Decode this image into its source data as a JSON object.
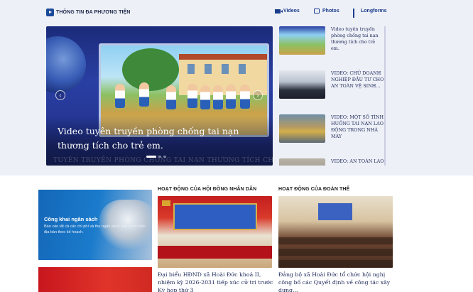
{
  "multimedia": {
    "title": "THÔNG TIN ĐA PHƯƠNG TIỆN",
    "nav": [
      {
        "label": "Videos",
        "icon": "video-icon"
      },
      {
        "label": "Photos",
        "icon": "photo-icon"
      },
      {
        "label": "Longforms",
        "icon": "chart-icon"
      }
    ],
    "slider": {
      "caption": "Video tuyên truyền phòng chống tai nạn thương tích cho trẻ em.",
      "overlay_text": "TUYÊN TRUYỀN PHÒNG CHỐNG TAI NẠN THƯƠNG TÍCH CHO TRẺ EM",
      "prev_icon": "chevron-left-icon",
      "next_icon": "chevron-right-icon",
      "active_slide": 1,
      "slide_count": 3
    },
    "video_list": [
      {
        "title": "Video tuyên truyền phòng chống tai nạn thương tích cho trẻ em."
      },
      {
        "title": "VIDEO: CHỦ DOANH NGHIỆP ĐẦU TƯ CHO AN TOÀN VỆ SINH..."
      },
      {
        "title": "VIDEO: MỘT SỐ TÌNH HUỐNG TAI NẠN LAO ĐỘNG TRONG NHÀ MÁY"
      },
      {
        "title": "VIDEO: AN TOÀN LAO"
      }
    ]
  },
  "banners": {
    "budget": {
      "title": "Công khai ngân sách",
      "description": "Báo cáo tất cả các chi phí và thu ngân sách nhà nước trên địa bàn theo kế hoạch."
    }
  },
  "sections": [
    {
      "heading": "HOẠT ĐỘNG CỦA HỘI ĐỒNG NHÂN DÂN",
      "article_title": "Đại biểu HĐND xã Hoài Đức khoá II, nhiệm kỳ 2026-2031 tiếp xúc cử tri trước Kỳ họp thứ 3"
    },
    {
      "heading": "HOẠT ĐỘNG CỦA ĐOÀN THỂ",
      "article_title": "Đảng bộ xã Hoài Đức tổ chức hội nghị công bố các Quyết định về công tác xây dựng..."
    }
  ]
}
